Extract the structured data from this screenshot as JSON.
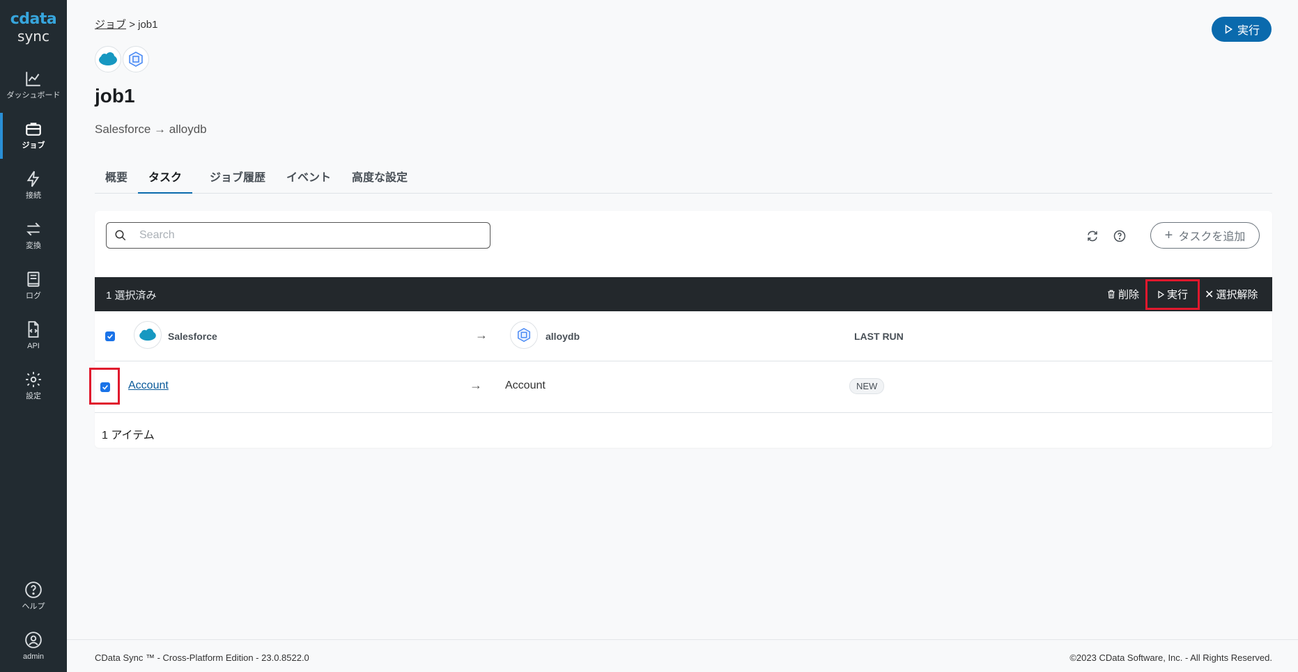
{
  "sidebar": {
    "logo_top": "cdata",
    "logo_bottom": "sync",
    "items": [
      {
        "label": "ダッシュボード",
        "icon": "chart-line-icon"
      },
      {
        "label": "ジョブ",
        "icon": "briefcase-icon",
        "active": true
      },
      {
        "label": "接続",
        "icon": "bolt-icon"
      },
      {
        "label": "変換",
        "icon": "arrows-swap-icon"
      },
      {
        "label": "ログ",
        "icon": "book-icon"
      },
      {
        "label": "API",
        "icon": "code-file-icon"
      },
      {
        "label": "設定",
        "icon": "gear-icon"
      }
    ],
    "bottom_items": [
      {
        "label": "ヘルプ",
        "icon": "help-circle-icon"
      },
      {
        "label": "admin",
        "icon": "user-circle-icon"
      }
    ]
  },
  "breadcrumb": {
    "parent": "ジョブ",
    "separator": ">",
    "current": "job1"
  },
  "header": {
    "run_label": "実行",
    "title": "job1",
    "subtitle": "Salesforce → alloydb"
  },
  "tabs": [
    {
      "label": "概要"
    },
    {
      "label": "タスク",
      "active": true
    },
    {
      "label": "ジョブ履歴"
    },
    {
      "label": "イベント"
    },
    {
      "label": "高度な設定"
    }
  ],
  "search": {
    "placeholder": "Search",
    "value": ""
  },
  "toolbar": {
    "add_task_label": "タスクを追加"
  },
  "selection_bar": {
    "count_label": "1 選択済み",
    "delete_label": "削除",
    "run_label": "実行",
    "clear_label": "選択解除"
  },
  "table": {
    "source_header": "Salesforce",
    "dest_header": "alloydb",
    "last_run_header": "LAST RUN",
    "rows": [
      {
        "source": "Account",
        "destination": "Account",
        "status": "NEW",
        "checked": true
      }
    ],
    "item_count": "1 アイテム"
  },
  "footer": {
    "left": "CData Sync ™ - Cross-Platform Edition - 23.0.8522.0",
    "right": "©2023 CData Software, Inc. - All Rights Reserved."
  },
  "colors": {
    "sidebar_bg": "#222b31",
    "accent": "#0a6aad",
    "highlight": "#e0182d",
    "selbar_bg": "#23282c"
  }
}
